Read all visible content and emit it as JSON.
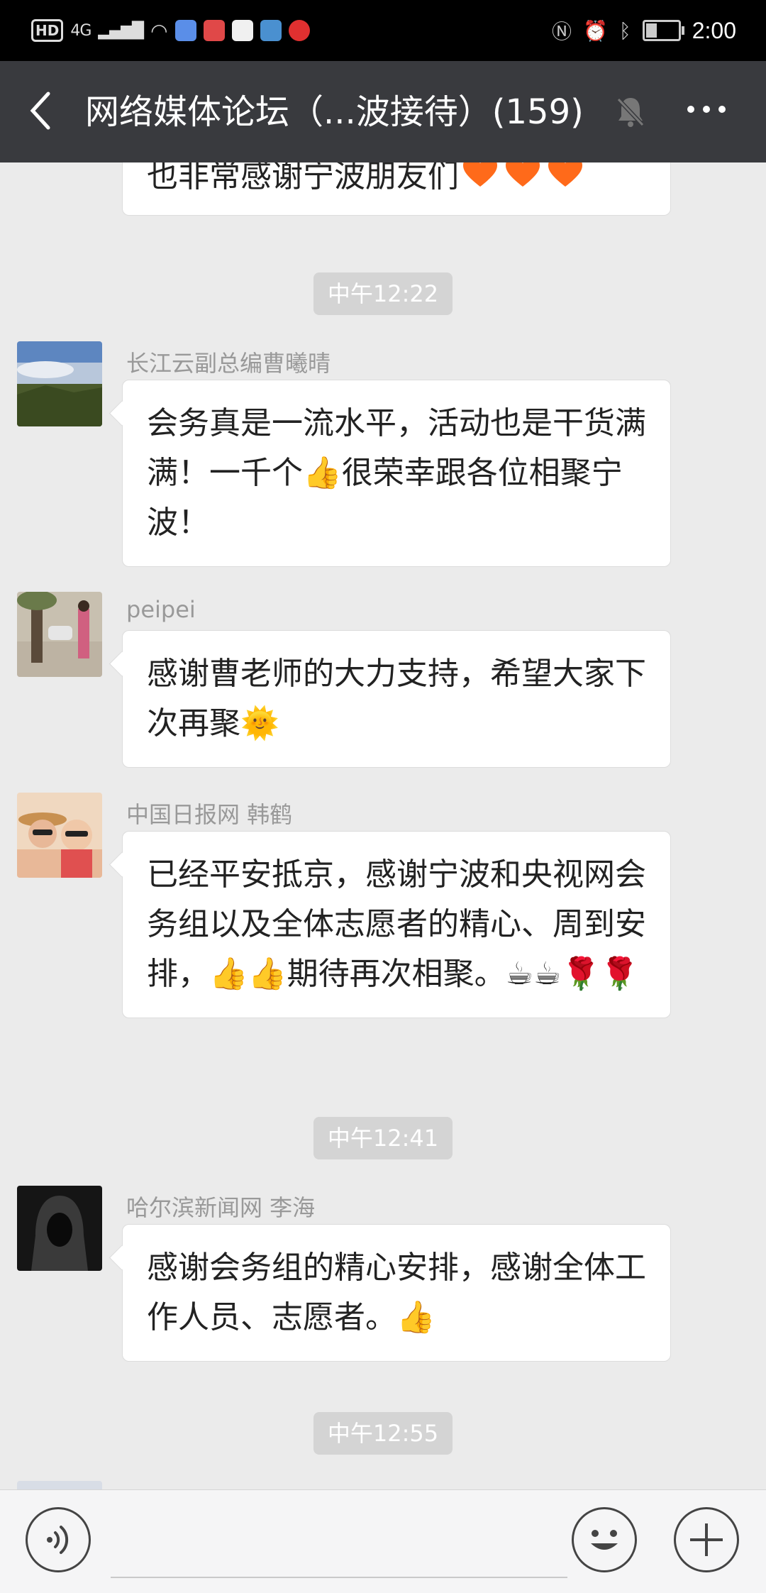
{
  "status_bar": {
    "hd": "HD",
    "network": "4G",
    "time": "2:00",
    "battery_level": 0.35
  },
  "header": {
    "title": "网络媒体论坛（...波接待）(159)",
    "back_icon": "chevron-left-icon",
    "mute_icon": "bell-muted-icon",
    "more_icon": "more-dots-icon"
  },
  "chat": {
    "top_message": {
      "text": "也非常感谢宁波朋友们",
      "emoji": [
        "orange-heart",
        "orange-heart",
        "orange-heart"
      ]
    },
    "timestamps": [
      "中午12:22",
      "中午12:41",
      "中午12:55"
    ],
    "messages": [
      {
        "sender": "长江云副总编曹曦晴",
        "avatar": "landscape-photo-avatar",
        "text": "会务真是一流水平，活动也是干货满满！一千个👍很荣幸跟各位相聚宁波！"
      },
      {
        "sender": "peipei",
        "avatar": "woman-street-photo-avatar",
        "text": "感谢曹老师的大力支持，希望大家下次再聚🌞"
      },
      {
        "sender": "中国日报网 韩鹤",
        "avatar": "family-photo-avatar",
        "text": "已经平安抵京，感谢宁波和央视网会务组以及全体志愿者的精心、周到安排，👍👍期待再次相聚。☕☕🌹🌹"
      },
      {
        "sender": "哈尔滨新闻网 李海",
        "avatar": "hooded-figure-avatar",
        "text": "感谢会务组的精心安排，感谢全体工作人员、志愿者。👍"
      }
    ]
  },
  "input_bar": {
    "voice_icon": "voice-icon",
    "emoji_icon": "smiley-icon",
    "plus_icon": "plus-icon",
    "text_value": ""
  },
  "colors": {
    "nav_background": "#393a3e",
    "chat_background": "#ebebeb",
    "bubble_background": "#ffffff",
    "timestamp_background": "#d4d4d4"
  }
}
